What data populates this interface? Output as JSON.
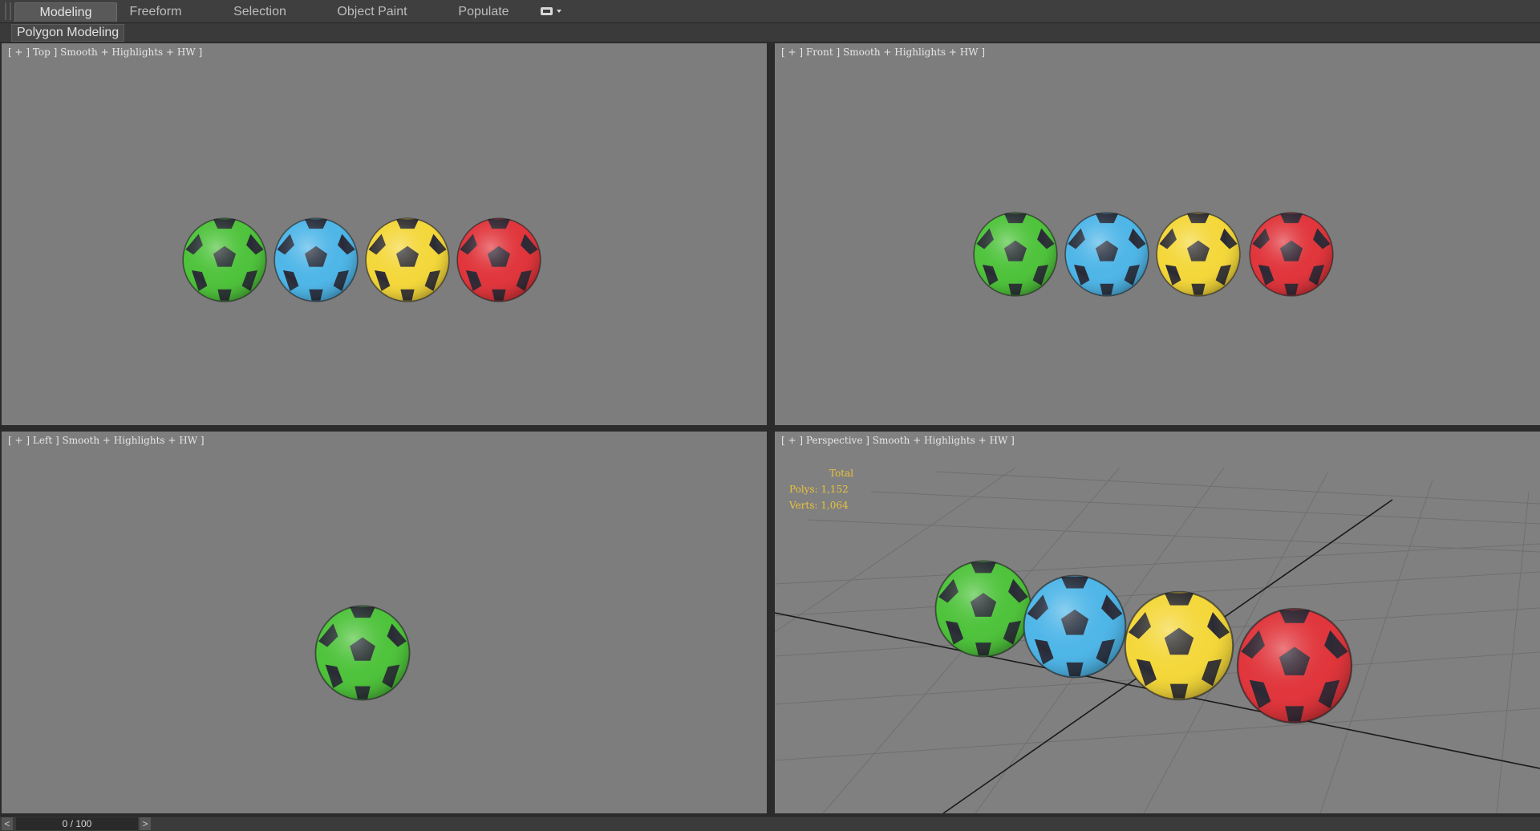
{
  "ribbon": {
    "tabs": [
      {
        "label": "Modeling",
        "active": true
      },
      {
        "label": "Freeform",
        "active": false
      },
      {
        "label": "Selection",
        "active": false
      },
      {
        "label": "Object Paint",
        "active": false
      },
      {
        "label": "Populate",
        "active": false
      }
    ],
    "panel_label": "Polygon Modeling",
    "overflow_icon": "ribbon-options-icon"
  },
  "viewports": {
    "top": {
      "label": "[ + ] Top ] Smooth + Highlights + HW ]"
    },
    "front": {
      "label": "[ + ] Front ] Smooth + Highlights + HW ]"
    },
    "left": {
      "label": "[ + ] Left ] Smooth + Highlights + HW ]"
    },
    "perspective": {
      "label": "[ + ] Perspective ] Smooth + Highlights + HW ]",
      "stats": {
        "total": "Total",
        "polys": "Polys: 1,152",
        "verts": "Verts: 1,064"
      }
    }
  },
  "balls": [
    {
      "color": "green",
      "hex": "#4fc33c"
    },
    {
      "color": "blue",
      "hex": "#4fb6e8"
    },
    {
      "color": "yellow",
      "hex": "#f4d73a"
    },
    {
      "color": "red",
      "hex": "#e0363c"
    }
  ],
  "patch_color": "#2a2a36",
  "timeline": {
    "frame": "0 / 100",
    "prev": "<",
    "next": ">"
  }
}
